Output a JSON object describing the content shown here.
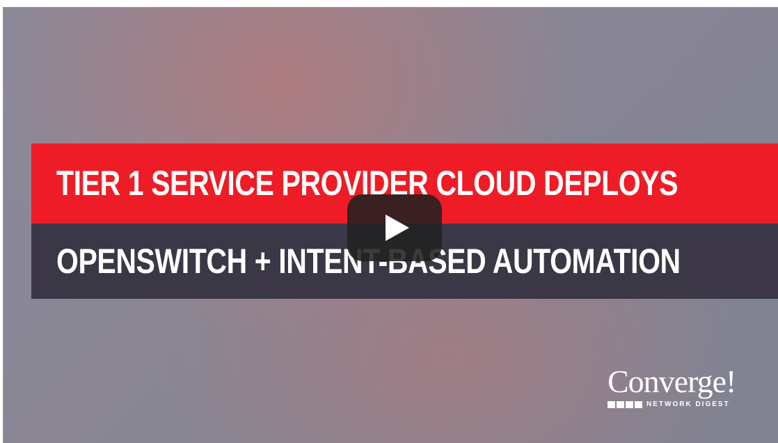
{
  "video": {
    "headline_line1": "TIER 1 SERVICE PROVIDER CLOUD DEPLOYS",
    "headline_line2": "OPENSWITCH + INTENT-BASED AUTOMATION",
    "play_icon": "play-icon"
  },
  "logo": {
    "word": "Converge!",
    "tagline": "NETWORK DIGEST"
  },
  "colors": {
    "red_band": "#ee1c26",
    "dark_band": "#3b3746",
    "play_button": "#212121"
  }
}
